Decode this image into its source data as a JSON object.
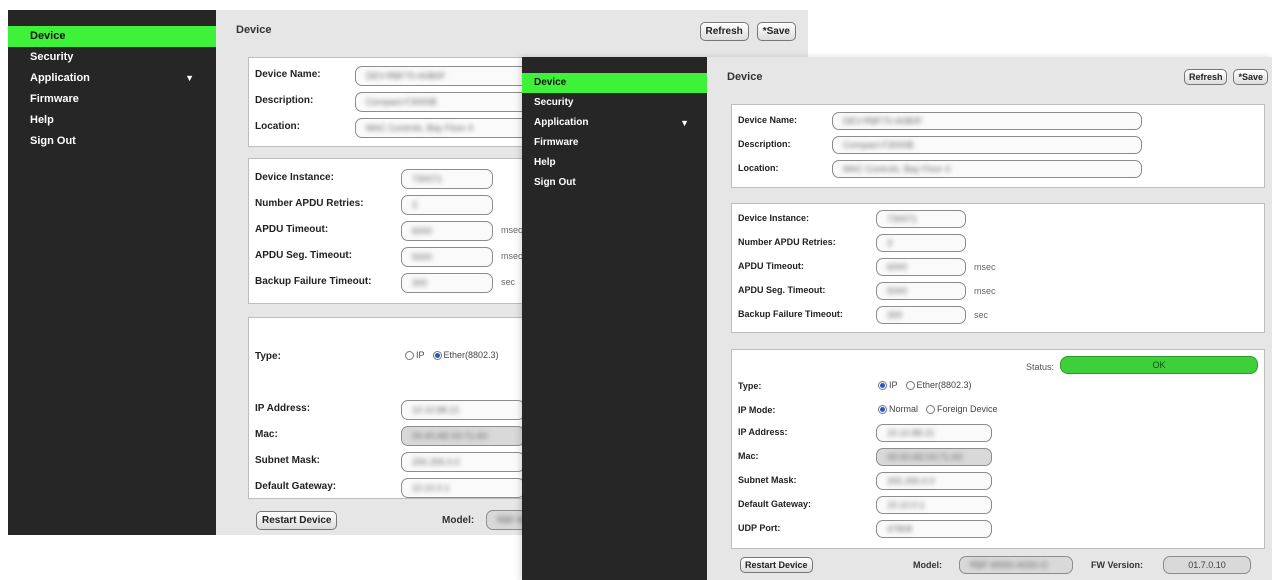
{
  "nav": {
    "items": [
      {
        "label": "Device"
      },
      {
        "label": "Security"
      },
      {
        "label": "Application",
        "arrow": "▼"
      },
      {
        "label": "Firmware"
      },
      {
        "label": "Help"
      },
      {
        "label": "Sign Out"
      }
    ]
  },
  "page_title": "Device",
  "toolbar": {
    "refresh_label": "Refresh",
    "save_label": "*Save"
  },
  "identity": {
    "device_name_label": "Device Name:",
    "description_label": "Description:",
    "location_label": "Location:",
    "device_name_value": "DEV-RBF70-A0B0F",
    "description_value": "Compact-F3000B",
    "location_value": "MAC Controls, Bay Floor 4"
  },
  "bacnet": {
    "device_instance_label": "Device Instance:",
    "apdu_retries_label": "Number APDU Retries:",
    "apdu_timeout_label": "APDU Timeout:",
    "apdu_seg_timeout_label": "APDU Seg. Timeout:",
    "backup_failure_label": "Backup Failure Timeout:",
    "device_instance_value": "730071",
    "apdu_retries_value": "3",
    "apdu_timeout_value": "6000",
    "apdu_seg_timeout_value": "5000",
    "backup_failure_value": "300",
    "unit_msec": "msec",
    "unit_sec": "sec"
  },
  "network": {
    "type_label": "Type:",
    "type_option_ip": "IP",
    "type_option_ether": "Ether(8802.3)",
    "ip_mode_label": "IP Mode:",
    "ip_mode_normal": "Normal",
    "ip_mode_foreign": "Foreign Device",
    "ip_address_label": "IP Address:",
    "mac_label": "Mac:",
    "subnet_mask_label": "Subnet Mask:",
    "default_gateway_label": "Default Gateway:",
    "udp_port_label": "UDP Port:",
    "status_label": "Status:",
    "status_value": "OK",
    "ip_address_value": "10.10.88.21",
    "mac_value": "00:40:AE:03:71:A0",
    "subnet_mask_value": "255.255.0.0",
    "default_gateway_value": "10.10.0.1",
    "udp_port_value": "47808"
  },
  "footer": {
    "restart_label": "Restart Device",
    "model_label": "Model:",
    "model_value": "RBF-M000-A000-O",
    "fw_version_label": "FW Version:",
    "fw_version_value": "01.7.0.10"
  },
  "colors": {
    "sidebar": "#262626",
    "active": "#3ef23a",
    "status_ok": "#3fcf3a",
    "panel": "#e6e6e6"
  }
}
